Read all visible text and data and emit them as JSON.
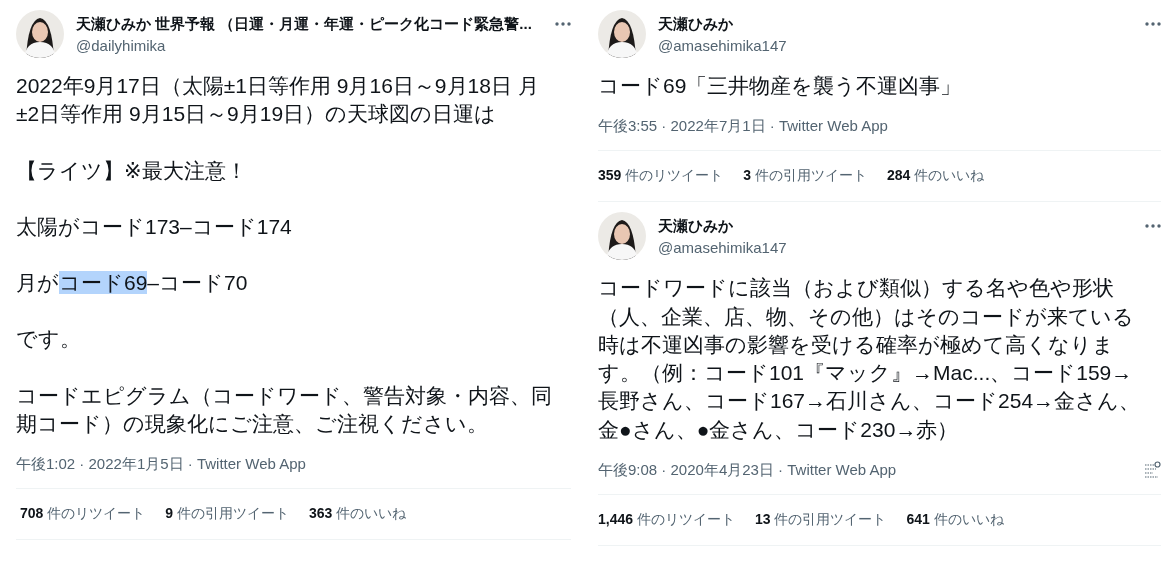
{
  "columns": [
    {
      "tweets": [
        {
          "name": "天瀬ひみか 世界予報 （日運・月運・年運・ピーク化コード緊急警...",
          "handle": "@dailyhimika",
          "analytics_icon": false,
          "paragraphs": [
            [
              {
                "text": "2022年9月17日（太陽±1日等作用 9月16日～9月18日 月±2日等作用 9月15日～9月19日）の天球図の日運は",
                "highlighted": false
              }
            ],
            [
              {
                "text": "【ライツ】※最大注意！",
                "highlighted": false
              }
            ],
            [
              {
                "text": "太陽がコード173–コード174",
                "highlighted": false
              }
            ],
            [
              {
                "text": "月が",
                "highlighted": false
              },
              {
                "text": "コード69",
                "highlighted": true
              },
              {
                "text": "–コード70",
                "highlighted": false
              }
            ],
            [
              {
                "text": "です。",
                "highlighted": false
              }
            ],
            [
              {
                "text": "コードエピグラム（コードワード、警告対象・内容、同期コード）の現象化にご注意、ご注視ください。",
                "highlighted": false
              }
            ]
          ],
          "meta": "午後1:02 · 2022年1月5日 · Twitter Web App",
          "stats": [
            {
              "count": "708",
              "label": "件のリツイート"
            },
            {
              "count": "9",
              "label": "件の引用ツイート"
            },
            {
              "count": "363",
              "label": "件のいいね"
            }
          ]
        }
      ]
    },
    {
      "tweets": [
        {
          "name": "天瀬ひみか",
          "handle": "@amasehimika147",
          "analytics_icon": false,
          "paragraphs": [
            [
              {
                "text": "コード69「三井物産を襲う不運凶事」",
                "highlighted": false
              }
            ]
          ],
          "meta": "午後3:55 · 2022年7月1日 · Twitter Web App",
          "stats": [
            {
              "count": "359",
              "label": "件のリツイート"
            },
            {
              "count": "3",
              "label": "件の引用ツイート"
            },
            {
              "count": "284",
              "label": "件のいいね"
            }
          ]
        },
        {
          "name": "天瀬ひみか",
          "handle": "@amasehimika147",
          "analytics_icon": true,
          "paragraphs": [
            [
              {
                "text": "コードワードに該当（および類似）する名や色や形状（人、企業、店、物、その他）はそのコードが来ている時は不運凶事の影響を受ける確率が極めて高くなります。（例：コード101『マック』→Mac...、コード159→長野さん、コード167→石川さん、コード254→金さん、金●さん、●金さん、コード230→赤）",
                "highlighted": false
              }
            ]
          ],
          "meta": "午後9:08 · 2020年4月23日 · Twitter Web App",
          "stats": [
            {
              "count": "1,446",
              "label": "件のリツイート"
            },
            {
              "count": "13",
              "label": "件の引用ツイート"
            },
            {
              "count": "641",
              "label": "件のいいね"
            }
          ]
        }
      ]
    }
  ]
}
